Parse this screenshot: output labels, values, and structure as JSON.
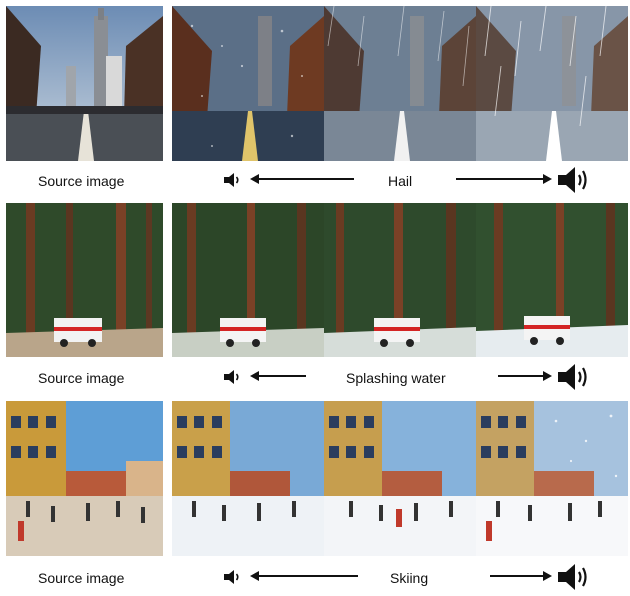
{
  "rows": [
    {
      "source_label": "Source image",
      "effect_label": "Hail",
      "scene": "city street"
    },
    {
      "source_label": "Source image",
      "effect_label": "Splashing water",
      "scene": "forest road with ambulance"
    },
    {
      "source_label": "Source image",
      "effect_label": "Skiing",
      "scene": "plaza with crowd"
    }
  ],
  "icons": {
    "speaker_low": "speaker-low-icon",
    "speaker_high": "speaker-high-icon",
    "arrow_left": "arrow-left-icon",
    "arrow_right": "arrow-right-icon"
  },
  "colors": {
    "background": "#ffffff",
    "text": "#111111"
  }
}
